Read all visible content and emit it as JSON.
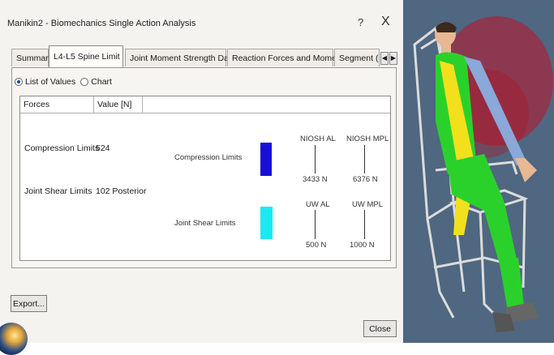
{
  "window": {
    "title": "Manikin2 - Biomechanics Single Action Analysis",
    "help": "?",
    "close_glyph": "X"
  },
  "tabs": [
    {
      "label": "Summary",
      "active": false
    },
    {
      "label": "L4-L5 Spine Limit",
      "active": true
    },
    {
      "label": "Joint Moment Strength Data",
      "active": false
    },
    {
      "label": "Reaction Forces and Moments",
      "active": false
    },
    {
      "label": "Segment (",
      "active": false
    }
  ],
  "tab_scroll": {
    "left_icon": "arrow-left-icon",
    "right_icon": "arrow-right-icon"
  },
  "view_mode": {
    "options": [
      "List of Values",
      "Chart"
    ],
    "selected": "List of Values"
  },
  "table": {
    "headers": [
      "Forces",
      "Value [N]"
    ],
    "rows": [
      {
        "force": "Compression Limits",
        "value": "524"
      },
      {
        "force": "Joint Shear Limits",
        "value": "102 Posterior"
      }
    ]
  },
  "mini_chart": {
    "compression": {
      "label": "Compression Limits",
      "color": "#1a0ddb",
      "limit_labels": [
        "NIOSH AL",
        "NIOSH MPL"
      ],
      "limit_values": [
        "3433 N",
        "6376 N"
      ]
    },
    "shear": {
      "label": "Joint Shear Limits",
      "color": "#19eaf2",
      "limit_labels": [
        "UW AL",
        "UW MPL"
      ],
      "limit_values": [
        "500 N",
        "1000 N"
      ]
    }
  },
  "buttons": {
    "export": "Export...",
    "close": "Close"
  },
  "colors": {
    "viewport_bg": "#4f6780",
    "skin": "#e8b892",
    "torso": "#2bd12b",
    "arm_upper": "#8aa8d8",
    "forearm": "#f2e01d",
    "reach_zone": "#c0122a"
  }
}
